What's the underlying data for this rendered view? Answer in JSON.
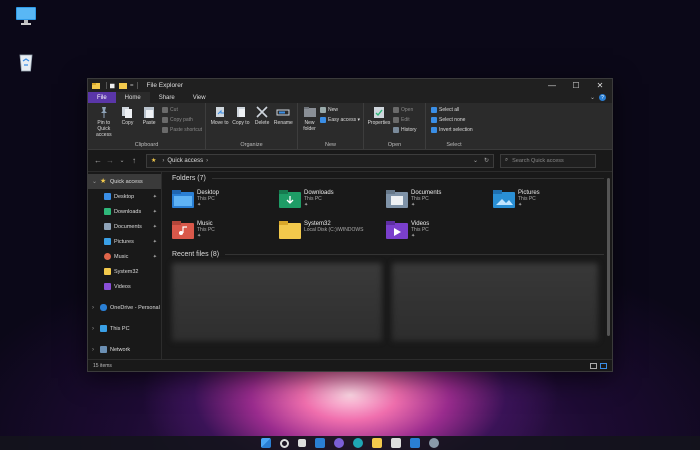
{
  "window": {
    "title": "File Explorer",
    "path_suffix": "="
  },
  "window_controls": {
    "minimize": "—",
    "maximize": "☐",
    "close": "✕"
  },
  "ribbon_tabs": [
    {
      "label": "File"
    },
    {
      "label": "Home"
    },
    {
      "label": "Share"
    },
    {
      "label": "View"
    }
  ],
  "ribbon": {
    "clipboard": {
      "label": "Clipboard",
      "pin": "Pin to Quick access",
      "copy": "Copy",
      "paste": "Paste",
      "cut": "Cut",
      "copy_path": "Copy path",
      "paste_shortcut": "Paste shortcut"
    },
    "organize": {
      "label": "Organize",
      "move_to": "Move to",
      "copy_to": "Copy to",
      "delete": "Delete",
      "rename": "Rename"
    },
    "new": {
      "label": "New",
      "new_folder": "New folder",
      "new_item": "New",
      "easy_access": "Easy access"
    },
    "open": {
      "label": "Open",
      "properties": "Properties",
      "open": "Open",
      "edit": "Edit",
      "history": "History"
    },
    "select": {
      "label": "Select",
      "select_all": "Select all",
      "select_none": "Select none",
      "invert": "Invert selection"
    }
  },
  "address": {
    "location": "Quick access",
    "search_placeholder": "Search Quick access"
  },
  "navpane": {
    "quick_access": "Quick access",
    "items": [
      {
        "label": "Desktop",
        "color": "#3a8ee6"
      },
      {
        "label": "Downloads",
        "color": "#2fb87a"
      },
      {
        "label": "Documents",
        "color": "#8fa3b8"
      },
      {
        "label": "Pictures",
        "color": "#3aa0e6"
      },
      {
        "label": "Music",
        "color": "#e0654a"
      },
      {
        "label": "System32",
        "color": "#f2c94c"
      },
      {
        "label": "Videos",
        "color": "#8a4fd8"
      }
    ],
    "onedrive": "OneDrive - Personal",
    "thispc": "This PC",
    "network": "Network"
  },
  "folders_title": "Folders (7)",
  "folders": [
    {
      "name": "Desktop",
      "location": "This PC",
      "pin": "📌",
      "color": "#3a8ee6"
    },
    {
      "name": "Downloads",
      "location": "This PC",
      "pin": "📌",
      "color": "#2fb87a"
    },
    {
      "name": "Documents",
      "location": "This PC",
      "pin": "📌",
      "color": "#8fa3b8"
    },
    {
      "name": "Pictures",
      "location": "This PC",
      "pin": "📌",
      "color": "#3aa0e6"
    },
    {
      "name": "Music",
      "location": "This PC",
      "pin": "📌",
      "color": "#e0654a"
    },
    {
      "name": "System32",
      "location": "Local Disk (C:)\\WINDOWS",
      "pin": "",
      "color": "#f2c94c"
    },
    {
      "name": "Videos",
      "location": "This PC",
      "pin": "📌",
      "color": "#8a4fd8"
    }
  ],
  "recent_title": "Recent files (8)",
  "status": {
    "items": "15 items"
  },
  "colors": {
    "accent": "#5a36a8",
    "window_bg": "#191919",
    "ribbon_bg": "#2b2b2b"
  }
}
